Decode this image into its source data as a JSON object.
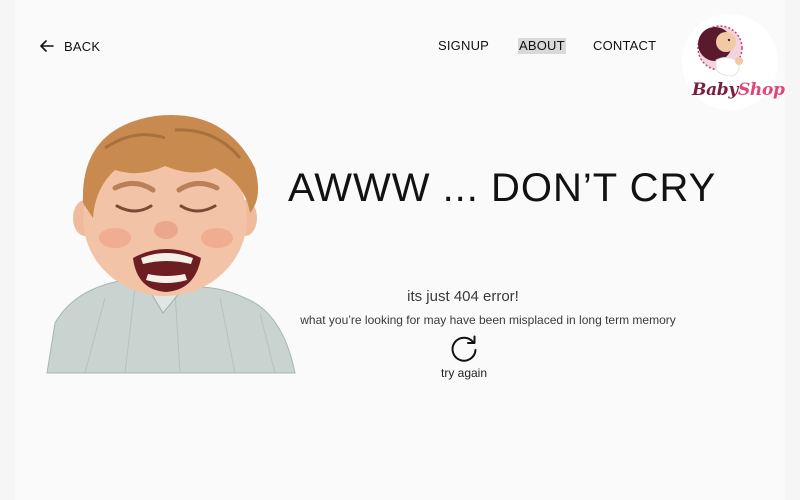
{
  "nav": {
    "back_label": "BACK",
    "signup_label": "SIGNUP",
    "about_label": "ABOUT",
    "contact_label": "CONTACT"
  },
  "brand": {
    "logo_part1": "Baby",
    "logo_part2": "Shop",
    "color_primary": "#7a1f3d",
    "color_accent": "#e0457b"
  },
  "error": {
    "headline": "AWWW ... DON’T CRY",
    "subtitle": "its just 404 error!",
    "description": "what you’re looking for may have been misplaced in long term memory",
    "retry_label": "try again"
  },
  "icons": {
    "back": "arrow-left-icon",
    "retry": "refresh-icon",
    "hero": "crying-toddler-illustration"
  }
}
